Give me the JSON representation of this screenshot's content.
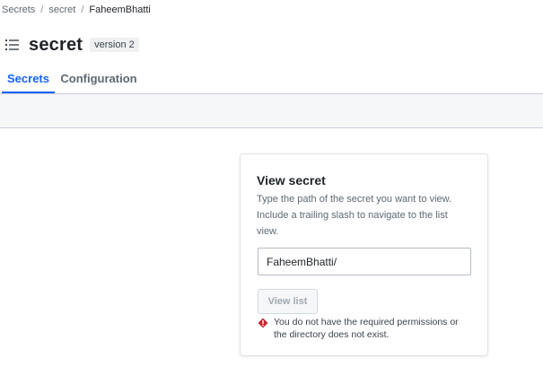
{
  "breadcrumb": {
    "items": [
      "Secrets",
      "secret",
      "FaheemBhatti"
    ],
    "separator": "/"
  },
  "header": {
    "icon": "list-icon",
    "title": "secret",
    "version_badge": "version 2"
  },
  "tabs": [
    {
      "label": "Secrets",
      "active": true
    },
    {
      "label": "Configuration",
      "active": false
    }
  ],
  "view_secret_card": {
    "title": "View secret",
    "description": "Type the path of the secret you want to view. Include a trailing slash to navigate to the list view.",
    "path_input_value": "FaheemBhatti/",
    "button_label": "View list",
    "button_disabled": true,
    "error_icon": "warning-diamond-icon",
    "error_message": "You do not have the required permissions or the directory does not exist."
  },
  "colors": {
    "accent": "#1563ff",
    "error": "#c52833",
    "text": "#1f2328",
    "muted": "#5f6872",
    "band": "#f6f7f9"
  }
}
